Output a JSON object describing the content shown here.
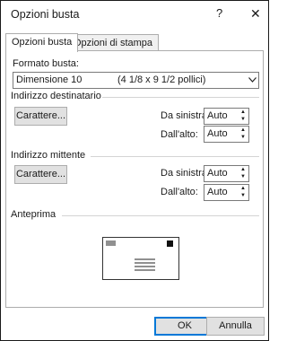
{
  "window": {
    "title": "Opzioni busta",
    "help_label": "?",
    "close_label": "✕"
  },
  "tabs": [
    {
      "label": "Opzioni busta",
      "active": true
    },
    {
      "label": "Opzioni di stampa",
      "active": false
    }
  ],
  "envelope_format": {
    "label": "Formato busta:",
    "selected_size": "Dimensione 10",
    "selected_dimensions": "(4 1/8 x 9 1/2 pollici)",
    "dropdown_icon": "chevron-down-icon"
  },
  "recipient": {
    "group_label": "Indirizzo destinatario",
    "font_button": "Carattere...",
    "left_label": "Da sinistra:",
    "left_value": "Auto",
    "top_label": "Dall'alto:",
    "top_value": "Auto"
  },
  "sender": {
    "group_label": "Indirizzo mittente",
    "font_button": "Carattere...",
    "left_label": "Da sinistra:",
    "left_value": "Auto",
    "top_label": "Dall'alto:",
    "top_value": "Auto"
  },
  "preview": {
    "group_label": "Anteprima"
  },
  "footer": {
    "ok_label": "OK",
    "cancel_label": "Annulla"
  },
  "colors": {
    "accent": "#0078d7",
    "button_face": "#e1e1e1",
    "border": "#adadad"
  }
}
